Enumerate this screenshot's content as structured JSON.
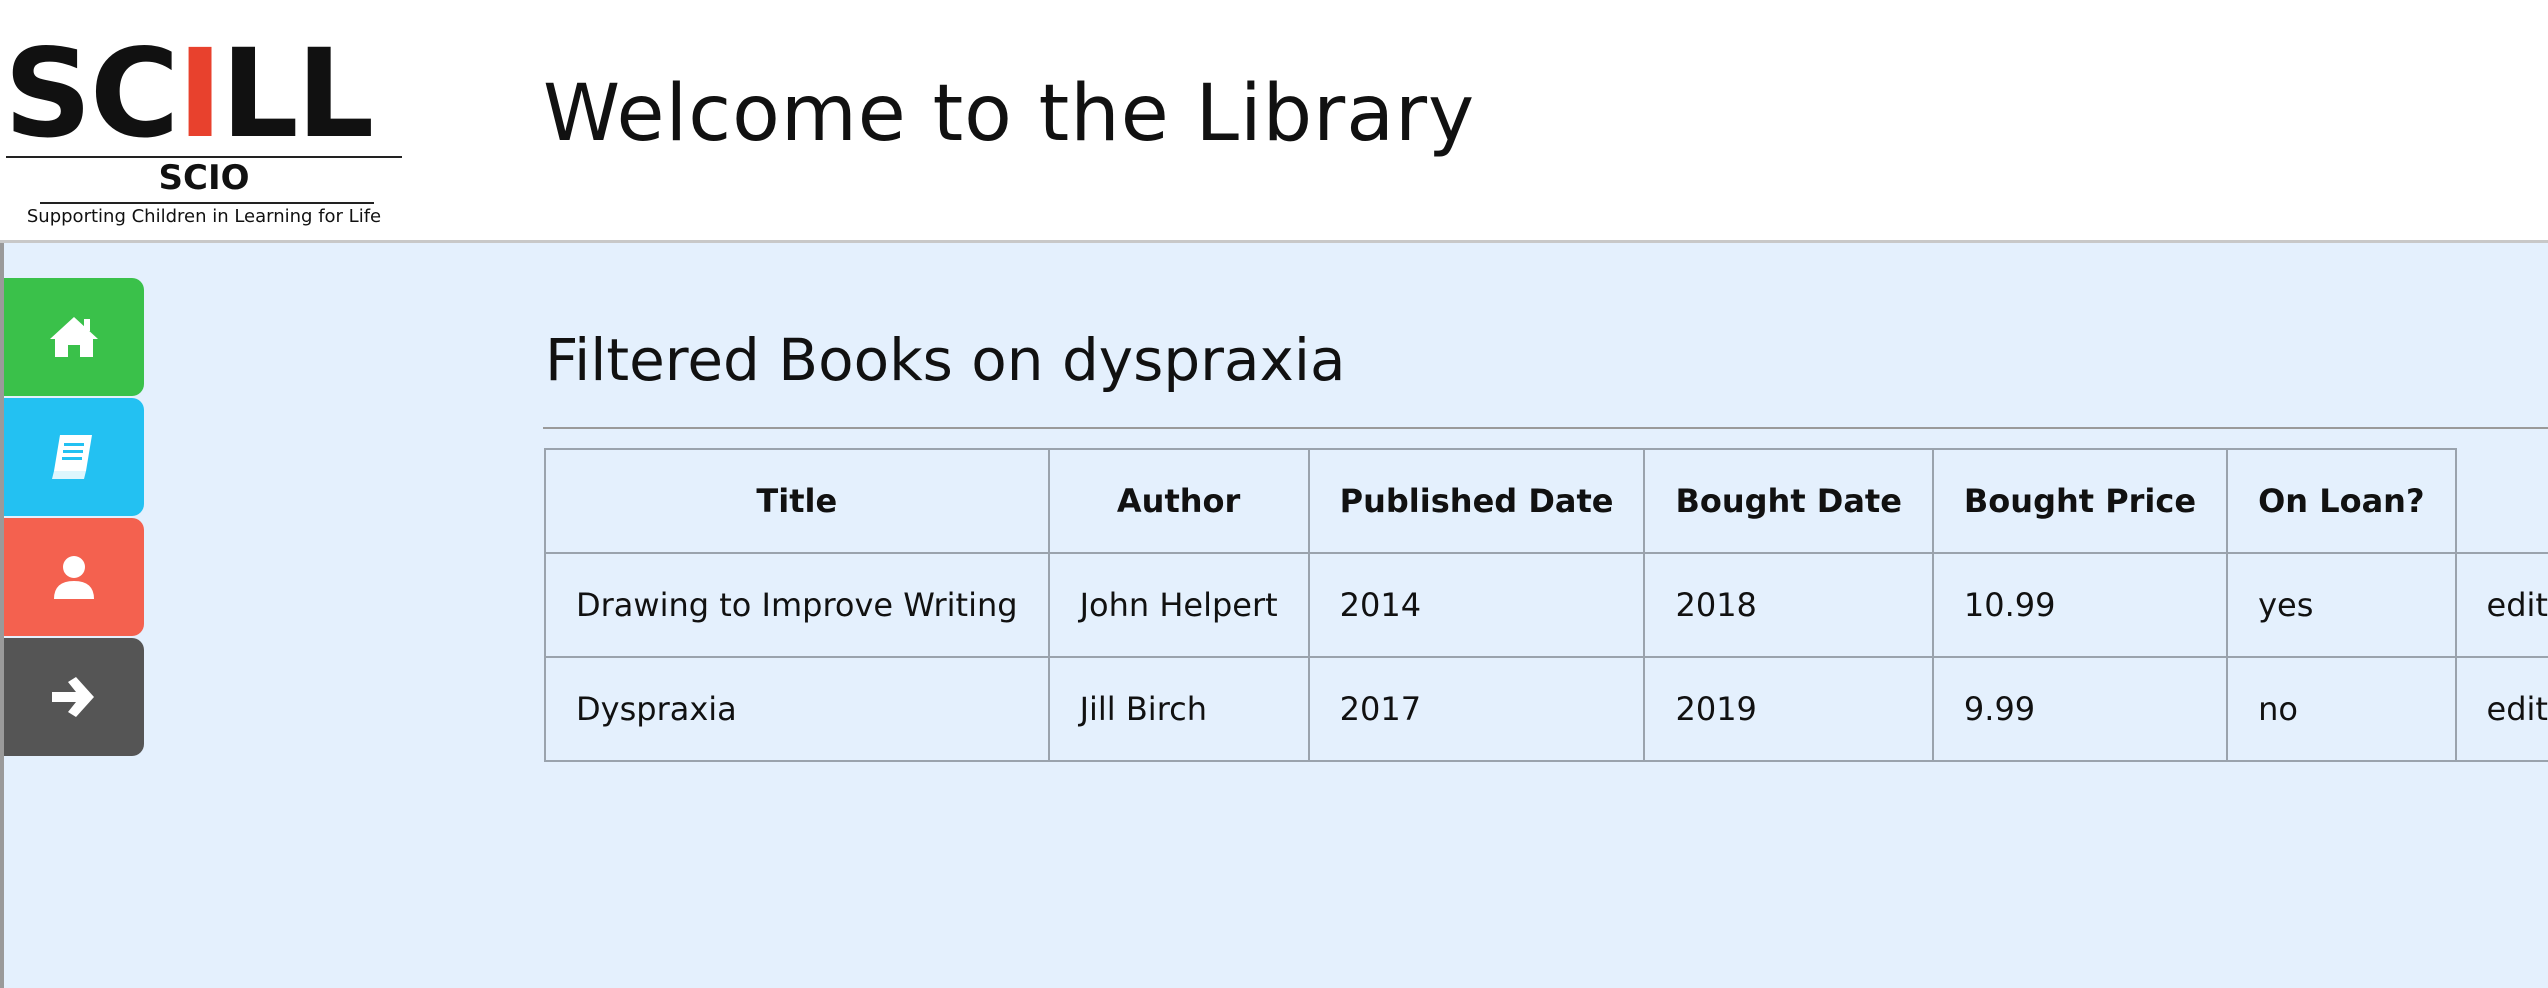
{
  "header": {
    "logo": {
      "word": "SCILL",
      "sub": "SCIO",
      "tagline": "Supporting Children in Learning for Life"
    },
    "title": "Welcome to the Library"
  },
  "sidebar": {
    "items": [
      {
        "name": "home",
        "icon": "home-icon",
        "color": "#3ac14a"
      },
      {
        "name": "books",
        "icon": "book-icon",
        "color": "#23c1f2"
      },
      {
        "name": "user",
        "icon": "user-icon",
        "color": "#f4614f"
      },
      {
        "name": "logout",
        "icon": "arrow-right-icon",
        "color": "#555555"
      }
    ]
  },
  "main": {
    "heading": "Filtered Books on dyspraxia",
    "table": {
      "headers": [
        "Title",
        "Author",
        "Published Date",
        "Bought Date",
        "Bought Price",
        "On Loan?"
      ],
      "rows": [
        {
          "title": "Drawing to Improve Writing",
          "author": "John Helpert",
          "published": "2014",
          "bought": "2018",
          "price": "10.99",
          "on_loan": "yes",
          "action": "edit"
        },
        {
          "title": "Dyspraxia",
          "author": "Jill Birch",
          "published": "2017",
          "bought": "2019",
          "price": "9.99",
          "on_loan": "no",
          "action": "edit"
        }
      ]
    }
  },
  "colors": {
    "content_bg": "#e4f0fd",
    "table_border": "#9aa3ad"
  }
}
